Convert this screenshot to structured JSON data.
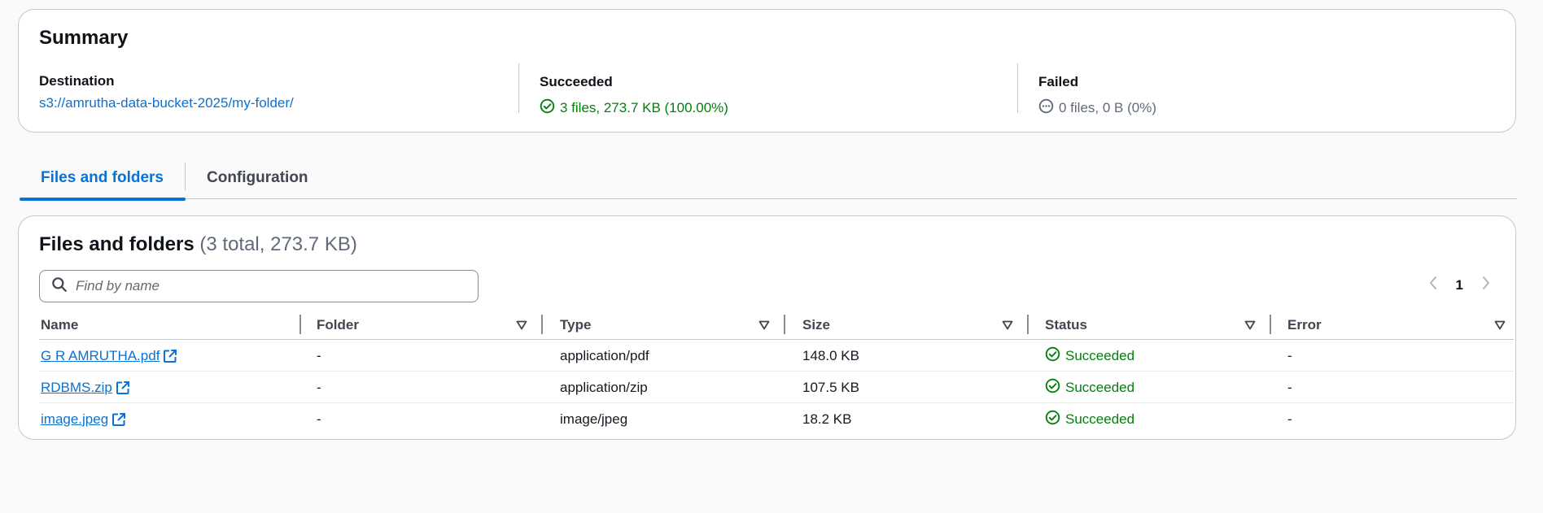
{
  "summary": {
    "title": "Summary",
    "destination_label": "Destination",
    "destination_value": "s3://amrutha-data-bucket-2025/my-folder/",
    "succeeded_label": "Succeeded",
    "succeeded_value": "3 files, 273.7 KB (100.00%)",
    "failed_label": "Failed",
    "failed_value": "0 files, 0 B (0%)"
  },
  "tabs": [
    {
      "label": "Files and folders",
      "active": true
    },
    {
      "label": "Configuration",
      "active": false
    }
  ],
  "files": {
    "title": "Files and folders",
    "count": "(3 total, 273.7 KB)",
    "search_placeholder": "Find by name",
    "page": "1",
    "columns": [
      "Name",
      "Folder",
      "Type",
      "Size",
      "Status",
      "Error"
    ],
    "rows": [
      {
        "name": "G R AMRUTHA.pdf",
        "folder": "-",
        "type": "application/pdf",
        "size": "148.0 KB",
        "status": "Succeeded",
        "error": "-"
      },
      {
        "name": "RDBMS.zip",
        "folder": "-",
        "type": "application/zip",
        "size": "107.5 KB",
        "status": "Succeeded",
        "error": "-"
      },
      {
        "name": "image.jpeg",
        "folder": "-",
        "type": "image/jpeg",
        "size": "18.2 KB",
        "status": "Succeeded",
        "error": "-"
      }
    ]
  },
  "icons": {
    "success": "status-success-icon",
    "in_progress": "status-pending-icon",
    "external": "external-link-icon",
    "sort": "sort-caret-icon",
    "search": "search-icon",
    "prev": "chevron-left-icon",
    "next": "chevron-right-icon"
  },
  "colors": {
    "link": "#0972d3",
    "success": "#037f0c",
    "muted": "#5f6b7a",
    "border": "#c6c6cd"
  }
}
